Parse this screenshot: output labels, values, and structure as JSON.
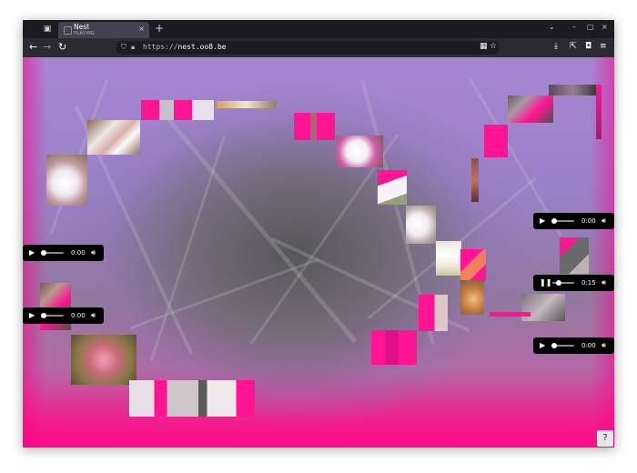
{
  "browser": {
    "tab_list_icon": "tab-list-icon",
    "tab": {
      "title": "Nest",
      "subtitle": "PLAYING",
      "close_label": "×"
    },
    "new_tab_label": "+",
    "window_controls": {
      "list": "⌄",
      "minimize": "–",
      "maximize": "▢",
      "close": "×"
    },
    "nav": {
      "back": "←",
      "forward": "→",
      "reload": "↻"
    },
    "url": {
      "scheme": "https://",
      "host": "nest.oo8.be"
    },
    "url_icons": [
      "shield-icon",
      "lock-icon",
      "extension-icon",
      "bookmark-star-icon"
    ],
    "toolbar_icons": [
      "download-icon",
      "share-icon",
      "shield-addon-icon",
      "menu-icon"
    ]
  },
  "players": [
    {
      "id": "p1",
      "state": "paused",
      "time": "0:00",
      "progress": 0.0
    },
    {
      "id": "p2",
      "state": "paused",
      "time": "0:00",
      "progress": 0.0
    },
    {
      "id": "p3",
      "state": "paused",
      "time": "0:00",
      "progress": 0.0
    },
    {
      "id": "p4",
      "state": "playing",
      "time": "0:15",
      "progress": 0.2
    },
    {
      "id": "p5",
      "state": "paused",
      "time": "0:00",
      "progress": 0.0
    }
  ],
  "help_label": "?",
  "colors": {
    "accent": "#ff0a88",
    "lavender": "#a686d2",
    "player": "#000000",
    "seek": "#3a8dde"
  }
}
